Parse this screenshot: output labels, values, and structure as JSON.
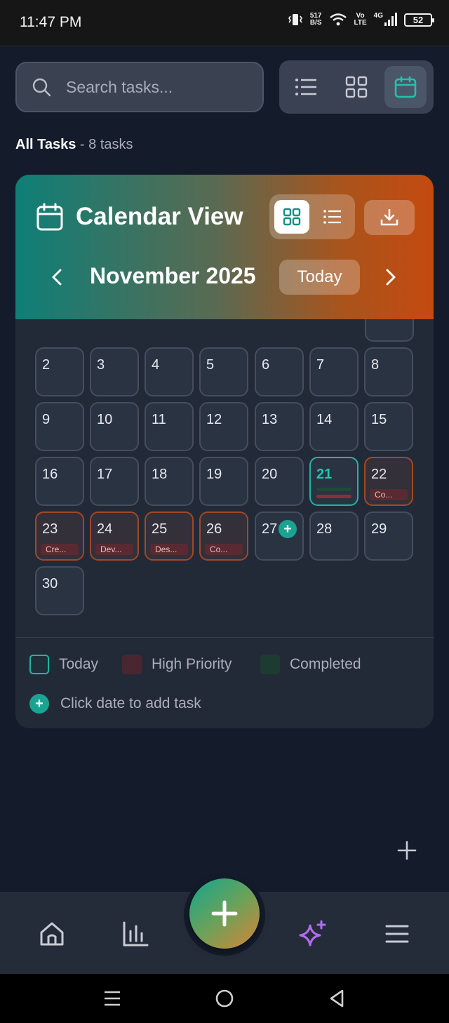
{
  "status_bar": {
    "time": "11:47 PM",
    "net_speed_value": "517",
    "net_speed_unit": "B/S",
    "volte_top": "Vo",
    "volte_bottom": "LTE",
    "network": "4G",
    "battery": "52"
  },
  "search": {
    "placeholder": "Search tasks..."
  },
  "view_switch": {
    "options": [
      "list-icon",
      "grid-icon",
      "calendar-icon"
    ],
    "active": "calendar"
  },
  "task_count": {
    "label": "All Tasks",
    "separator": "-",
    "count_text": "8 tasks"
  },
  "calendar": {
    "title": "Calendar View",
    "month_label": "November 2025",
    "today_button": "Today",
    "colors": {
      "header_start": "#0e7f77",
      "header_end": "#c44a10",
      "today": "#1fb6a3",
      "high_priority": "#a14827",
      "completed": "#1d3b31"
    },
    "days": [
      {
        "num": "2"
      },
      {
        "num": "3"
      },
      {
        "num": "4"
      },
      {
        "num": "5"
      },
      {
        "num": "6"
      },
      {
        "num": "7"
      },
      {
        "num": "8"
      },
      {
        "num": "9"
      },
      {
        "num": "10"
      },
      {
        "num": "11"
      },
      {
        "num": "12"
      },
      {
        "num": "13"
      },
      {
        "num": "14"
      },
      {
        "num": "15"
      },
      {
        "num": "16"
      },
      {
        "num": "17"
      },
      {
        "num": "18"
      },
      {
        "num": "19"
      },
      {
        "num": "20"
      },
      {
        "num": "21",
        "state": "today"
      },
      {
        "num": "22",
        "state": "high-priority",
        "task": "Co..."
      },
      {
        "num": "23",
        "state": "high-priority",
        "task": "Cre..."
      },
      {
        "num": "24",
        "state": "high-priority",
        "task": "Dev..."
      },
      {
        "num": "25",
        "state": "high-priority",
        "task": "Des..."
      },
      {
        "num": "26",
        "state": "high-priority",
        "task": "Co..."
      },
      {
        "num": "27",
        "add": "+"
      },
      {
        "num": "28"
      },
      {
        "num": "29"
      },
      {
        "num": "30"
      }
    ]
  },
  "legend": {
    "today": "Today",
    "high_priority": "High Priority",
    "completed": "Completed",
    "hint_icon": "+",
    "hint": "Click date to add task"
  },
  "bottom_nav": {
    "items": [
      "home-icon",
      "stats-icon",
      "add-icon",
      "ai-sparkle-icon",
      "menu-icon"
    ]
  },
  "system_nav": {
    "items": [
      "recents-icon",
      "home-circle-icon",
      "back-icon"
    ]
  }
}
